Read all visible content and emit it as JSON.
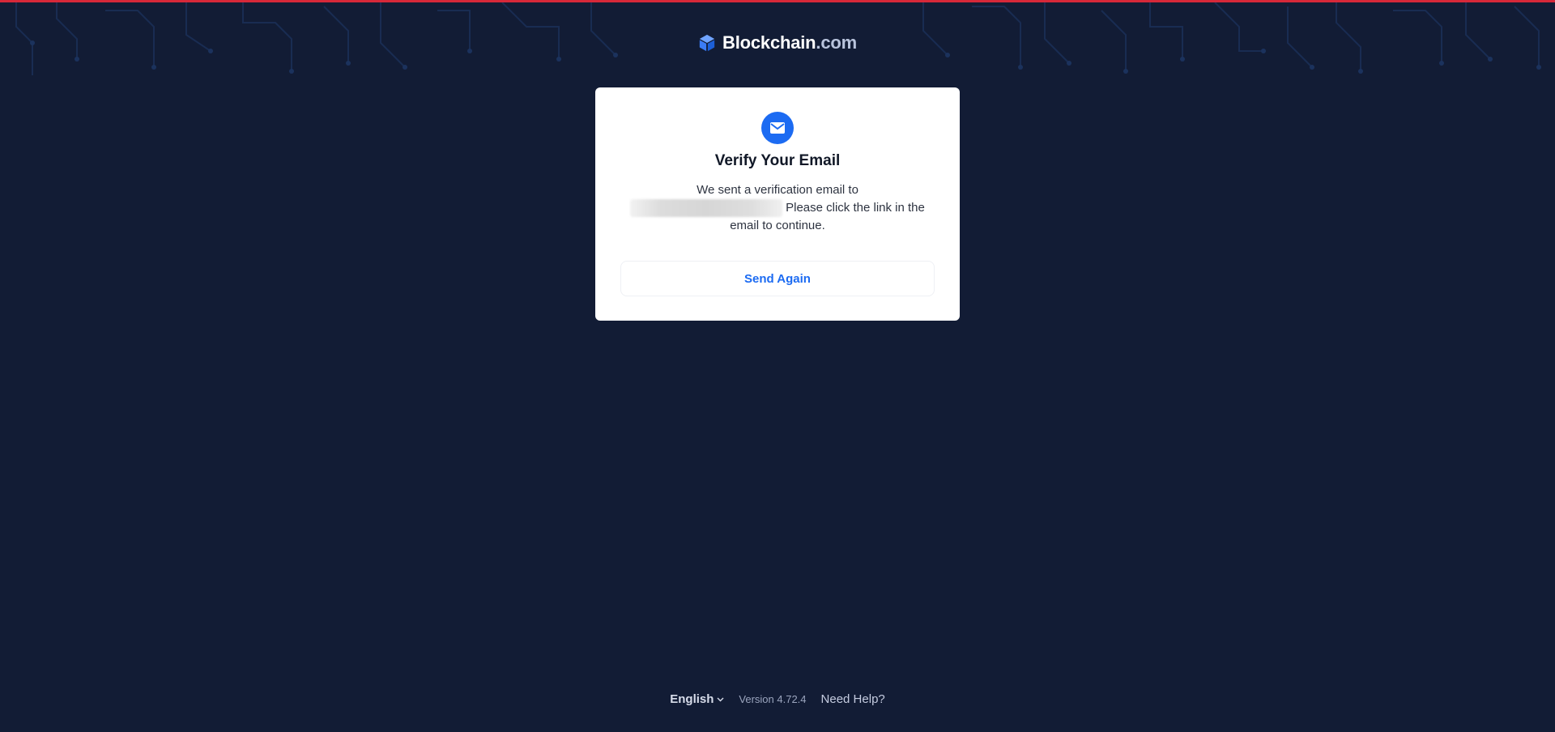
{
  "brand": {
    "name_main": "Blockchain",
    "name_suffix": ".com",
    "icon": "blockchain-cube-icon",
    "accent_color": "#1c6bf2"
  },
  "card": {
    "icon": "envelope-icon",
    "title": "Verify Your Email",
    "message_intro": "We sent a verification email to",
    "message_outro": "Please click the link in the email to continue.",
    "send_again_label": "Send Again"
  },
  "footer": {
    "language": "English",
    "version": "Version 4.72.4",
    "help": "Need Help?"
  },
  "colors": {
    "background": "#121c35",
    "top_accent": "#d62839",
    "card": "#ffffff",
    "link": "#1c6bf2"
  }
}
